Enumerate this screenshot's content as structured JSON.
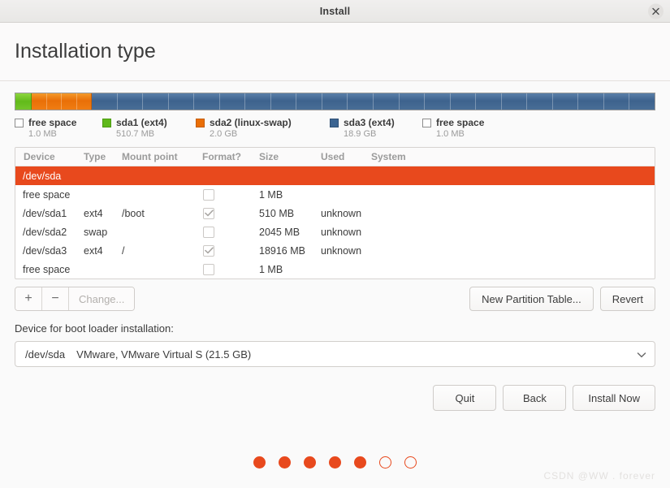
{
  "window": {
    "title": "Install",
    "close_icon": "close-icon"
  },
  "page": {
    "title": "Installation type"
  },
  "disk_bar": {
    "segments": [
      {
        "name": "free space",
        "color": "#ffffff",
        "pct": 2.4
      },
      {
        "name": "sda1 (ext4)",
        "color": "#5fb91a",
        "pct": 9.4
      },
      {
        "name": "sda2 (linux-swap)",
        "color": "#ea6e06",
        "pct": 88.2
      }
    ]
  },
  "legend": [
    {
      "label": "free space",
      "size": "1.0 MB",
      "swatch": "sw-free",
      "icon": "free-space-swatch-icon"
    },
    {
      "label": "sda1 (ext4)",
      "size": "510.7 MB",
      "swatch": "sw-green",
      "icon": "sda1-swatch-icon"
    },
    {
      "label": "sda2 (linux-swap)",
      "size": "2.0 GB",
      "swatch": "sw-orange",
      "icon": "sda2-swatch-icon"
    },
    {
      "label": "sda3 (ext4)",
      "size": "18.9 GB",
      "swatch": "sw-blue",
      "icon": "sda3-swatch-icon"
    },
    {
      "label": "free space",
      "size": "1.0 MB",
      "swatch": "sw-free",
      "icon": "free-space-swatch-icon-2"
    }
  ],
  "table": {
    "columns": [
      "Device",
      "Type",
      "Mount point",
      "Format?",
      "Size",
      "Used",
      "System"
    ],
    "rows": [
      {
        "device": "/dev/sda",
        "type": "",
        "mount": "",
        "format": null,
        "size": "",
        "used": "",
        "system": "",
        "selected": true
      },
      {
        "device": "free space",
        "type": "",
        "mount": "",
        "format": false,
        "size": "1 MB",
        "used": "",
        "system": "",
        "selected": false
      },
      {
        "device": "/dev/sda1",
        "type": "ext4",
        "mount": "/boot",
        "format": true,
        "size": "510 MB",
        "used": "unknown",
        "system": "",
        "selected": false
      },
      {
        "device": "/dev/sda2",
        "type": "swap",
        "mount": "",
        "format": false,
        "size": "2045 MB",
        "used": "unknown",
        "system": "",
        "selected": false
      },
      {
        "device": "/dev/sda3",
        "type": "ext4",
        "mount": "/",
        "format": true,
        "size": "18916 MB",
        "used": "unknown",
        "system": "",
        "selected": false
      },
      {
        "device": "free space",
        "type": "",
        "mount": "",
        "format": false,
        "size": "1 MB",
        "used": "",
        "system": "",
        "selected": false
      }
    ]
  },
  "actions": {
    "add_label": "+",
    "remove_label": "−",
    "change_label": "Change...",
    "new_partition_table_label": "New Partition Table...",
    "revert_label": "Revert"
  },
  "bootloader": {
    "label": "Device for boot loader installation:",
    "selected_device": "/dev/sda",
    "selected_description": "VMware, VMware Virtual S (21.5 GB)",
    "chevron_icon": "chevron-down-icon"
  },
  "footer": {
    "quit_label": "Quit",
    "back_label": "Back",
    "install_label": "Install Now"
  },
  "progress_dots": {
    "total": 7,
    "completed": 5,
    "states": [
      "filled",
      "filled",
      "filled",
      "filled",
      "filled",
      "hollow",
      "hollow"
    ]
  },
  "watermark": {
    "text": "CSDN @WW . forever"
  },
  "colors": {
    "accent": "#e8491d",
    "green": "#5fb91a",
    "orange": "#ea6e06",
    "blue": "#3b6491",
    "background": "#fafafa"
  }
}
